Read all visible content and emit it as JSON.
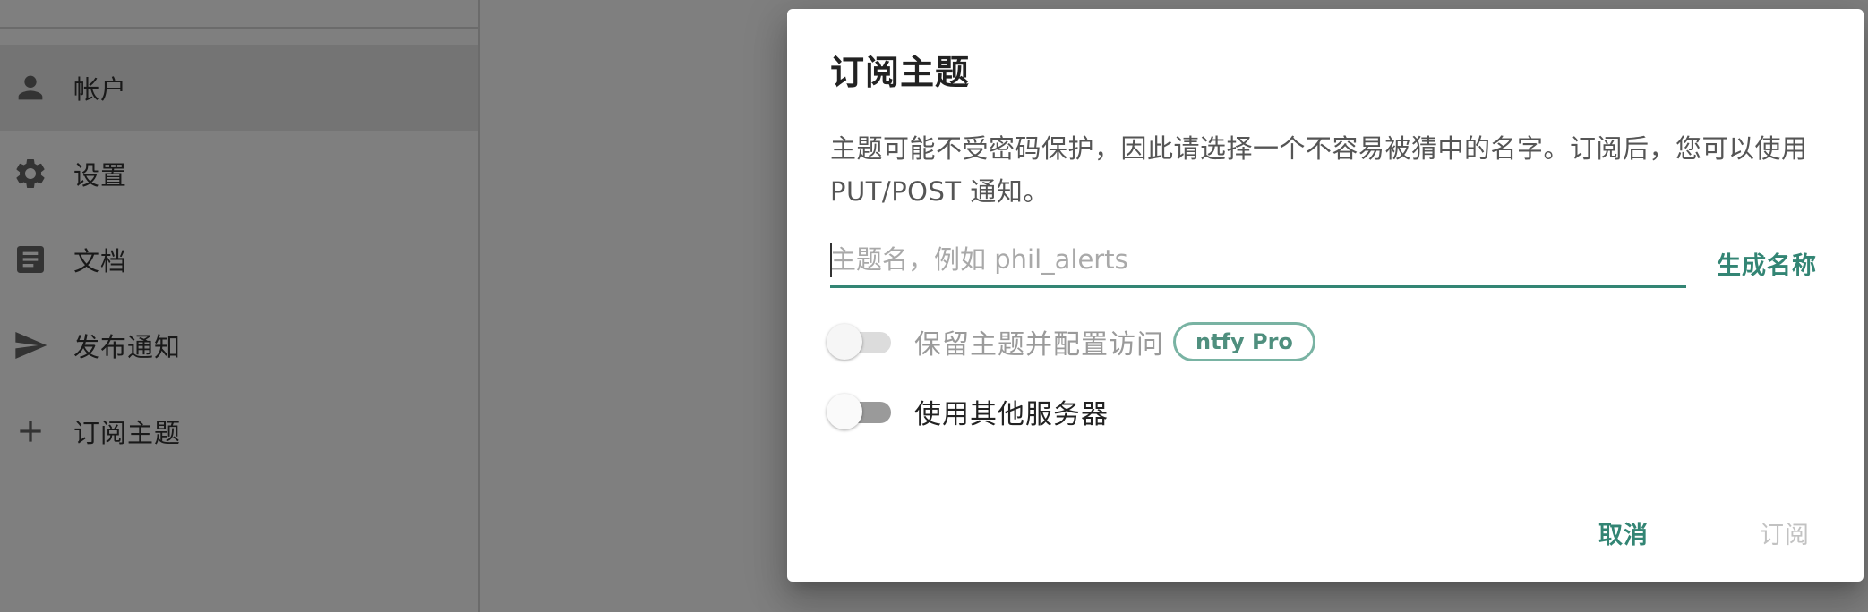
{
  "sidebar": {
    "items": [
      {
        "label": "帐户",
        "icon": "person-icon",
        "selected": true
      },
      {
        "label": "设置",
        "icon": "gear-icon",
        "selected": false
      },
      {
        "label": "文档",
        "icon": "document-icon",
        "selected": false
      },
      {
        "label": "发布通知",
        "icon": "send-icon",
        "selected": false
      },
      {
        "label": "订阅主题",
        "icon": "plus-icon",
        "selected": false
      }
    ]
  },
  "dialog": {
    "title": "订阅主题",
    "description": "主题可能不受密码保护，因此请选择一个不容易被猜中的名字。订阅后，您可以使用 PUT/POST 通知。",
    "topic_input": {
      "value": "",
      "placeholder": "主题名，例如 phil_alerts"
    },
    "generate_label": "生成名称",
    "reserve_toggle": {
      "label": "保留主题并配置访问",
      "badge": "ntfy Pro",
      "checked": false,
      "disabled": true
    },
    "other_server_toggle": {
      "label": "使用其他服务器",
      "checked": false
    },
    "actions": {
      "cancel_label": "取消",
      "subscribe_label": "订阅"
    }
  },
  "colors": {
    "accent": "#338574",
    "badge_border": "#79b3a3",
    "scrim": "rgba(0,0,0,0.5)",
    "disabled_text": "#c2c2c2"
  }
}
